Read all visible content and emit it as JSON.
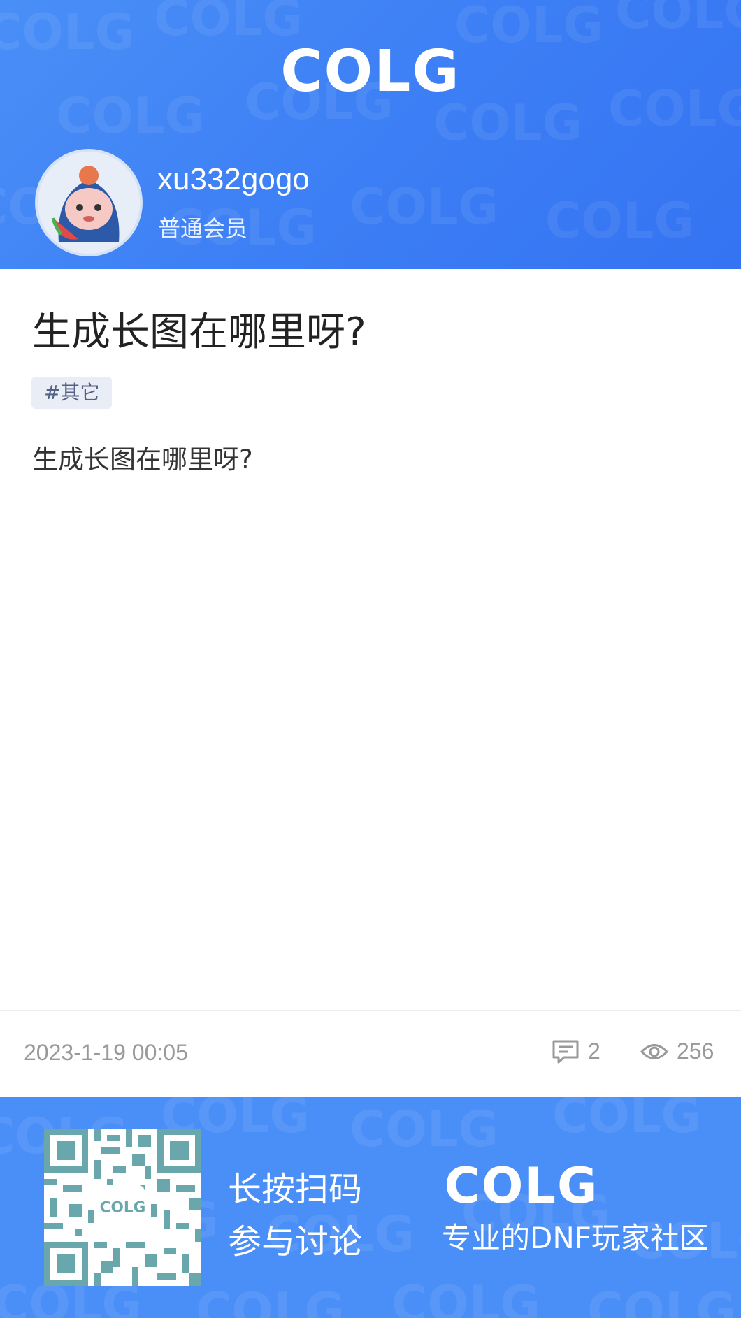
{
  "header": {
    "logo_text": "COLG",
    "user": {
      "name": "xu332gogo",
      "role": "普通会员",
      "avatar": "avatar-cartoon-icon"
    }
  },
  "post": {
    "title": "生成长图在哪里呀?",
    "tag": "#其它",
    "content": "生成长图在哪里呀?"
  },
  "meta": {
    "date": "2023-1-19 00:05",
    "comments": "2",
    "views": "256"
  },
  "footer": {
    "scan_line1": "长按扫码",
    "scan_line2": "参与讨论",
    "logo_text": "COLG",
    "slogan": "专业的DNF玩家社区"
  },
  "colors": {
    "brand_blue": "#3d7ff5",
    "footer_blue": "#4a8ff7"
  }
}
